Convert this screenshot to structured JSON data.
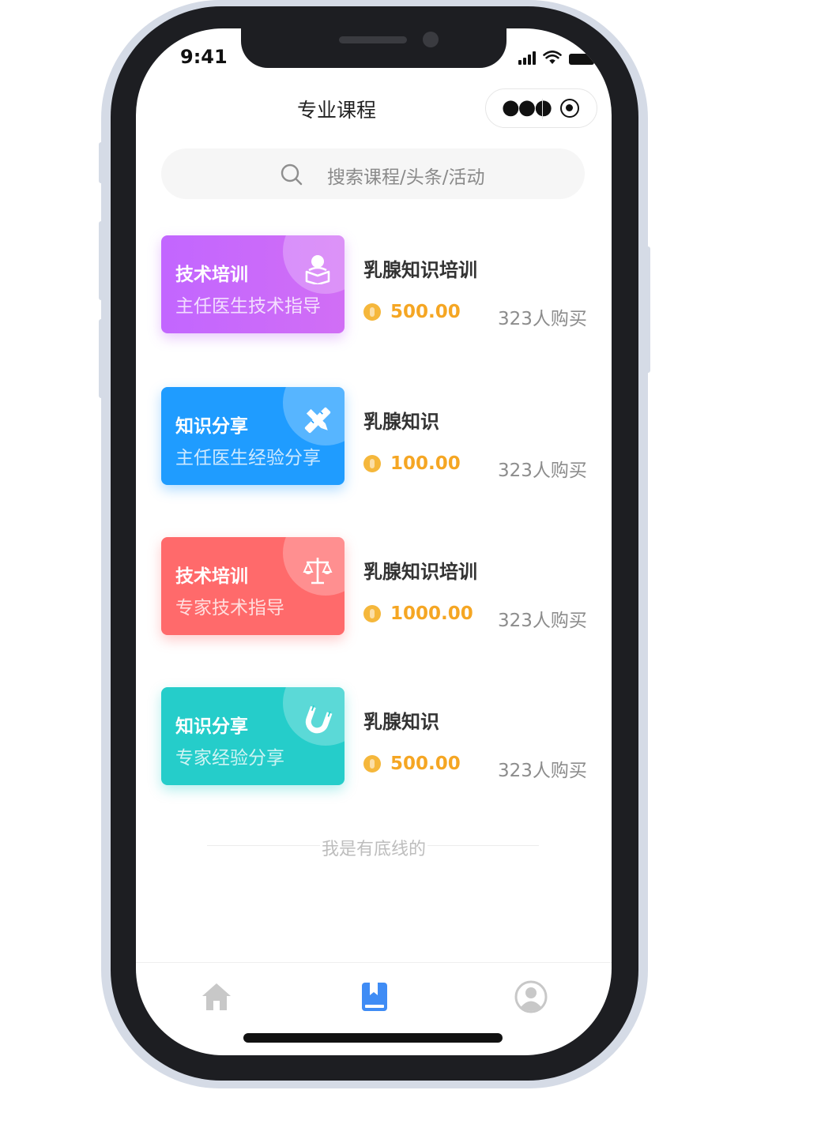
{
  "status_bar": {
    "time": "9:41"
  },
  "nav": {
    "title": "专业课程",
    "more_icon": "more-dots-icon",
    "close_icon": "target-icon"
  },
  "search": {
    "placeholder": "搜索课程/头条/活动",
    "icon": "search-icon"
  },
  "courses": [
    {
      "tag": "技术培训",
      "subtitle": "主任医生技术指导",
      "title": "乳腺知识培训",
      "price": "500.00",
      "buyers": "323人购买",
      "icon": "reader-icon",
      "color": "#c266ff"
    },
    {
      "tag": "知识分享",
      "subtitle": "主任医生经验分享",
      "title": "乳腺知识",
      "price": "100.00",
      "buyers": "323人购买",
      "icon": "pencil-ruler-icon",
      "color": "#1f9cff"
    },
    {
      "tag": "技术培训",
      "subtitle": "专家技术指导",
      "title": "乳腺知识培训",
      "price": "1000.00",
      "buyers": "323人购买",
      "icon": "scale-icon",
      "color": "#ff6a6b"
    },
    {
      "tag": "知识分享",
      "subtitle": "专家经验分享",
      "title": "乳腺知识",
      "price": "500.00",
      "buyers": "323人购买",
      "icon": "magnet-icon",
      "color": "#25cdca"
    }
  ],
  "footer_text": "我是有底线的",
  "tabbar": {
    "tabs": [
      {
        "icon": "home-icon",
        "active": false
      },
      {
        "icon": "book-icon",
        "active": true
      },
      {
        "icon": "user-icon",
        "active": false
      }
    ],
    "active_color": "#3f8cf5",
    "inactive_color": "#c8c8c8"
  }
}
